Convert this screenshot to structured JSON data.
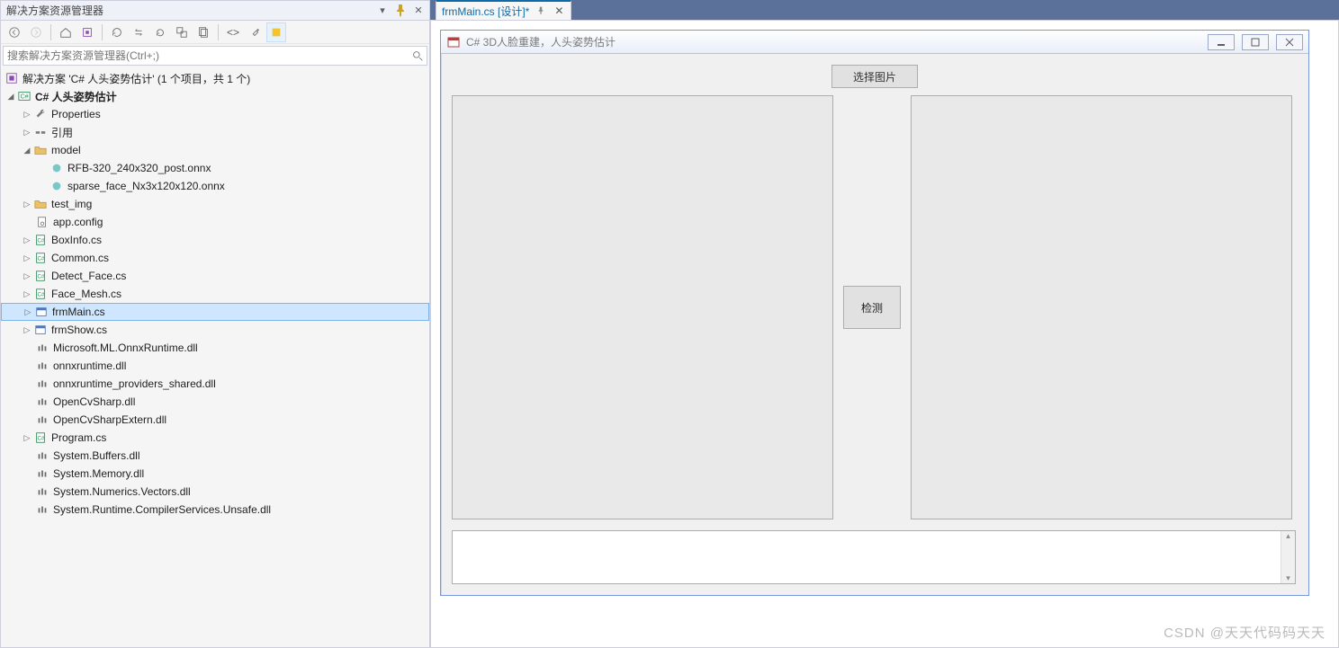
{
  "solution_explorer": {
    "title": "解决方案资源管理器",
    "search_placeholder": "搜索解决方案资源管理器(Ctrl+;)",
    "solution_line": "解决方案 'C# 人头姿势估计' (1 个项目，共 1 个)",
    "project": "C# 人头姿势估计",
    "items": {
      "properties": "Properties",
      "refs": "引用",
      "model": "model",
      "onnx1": "RFB-320_240x320_post.onnx",
      "onnx2": "sparse_face_Nx3x120x120.onnx",
      "test_img": "test_img",
      "app_config": "app.config",
      "boxinfo": "BoxInfo.cs",
      "common": "Common.cs",
      "detect_face": "Detect_Face.cs",
      "face_mesh": "Face_Mesh.cs",
      "frmmain": "frmMain.cs",
      "frmshow": "frmShow.cs",
      "ml_onnx": "Microsoft.ML.OnnxRuntime.dll",
      "onnxruntime": "onnxruntime.dll",
      "onnx_prov": "onnxruntime_providers_shared.dll",
      "opencvsharp": "OpenCvSharp.dll",
      "opencvsharpextern": "OpenCvSharpExtern.dll",
      "program": "Program.cs",
      "buffers": "System.Buffers.dll",
      "memory": "System.Memory.dll",
      "numvec": "System.Numerics.Vectors.dll",
      "unsafe": "System.Runtime.CompilerServices.Unsafe.dll"
    }
  },
  "tab": {
    "title": "frmMain.cs [设计]*"
  },
  "form": {
    "title": "C# 3D人脸重建，人头姿势估计",
    "select_btn": "选择图片",
    "detect_btn": "检测"
  },
  "watermark": "CSDN @天天代码码天天"
}
